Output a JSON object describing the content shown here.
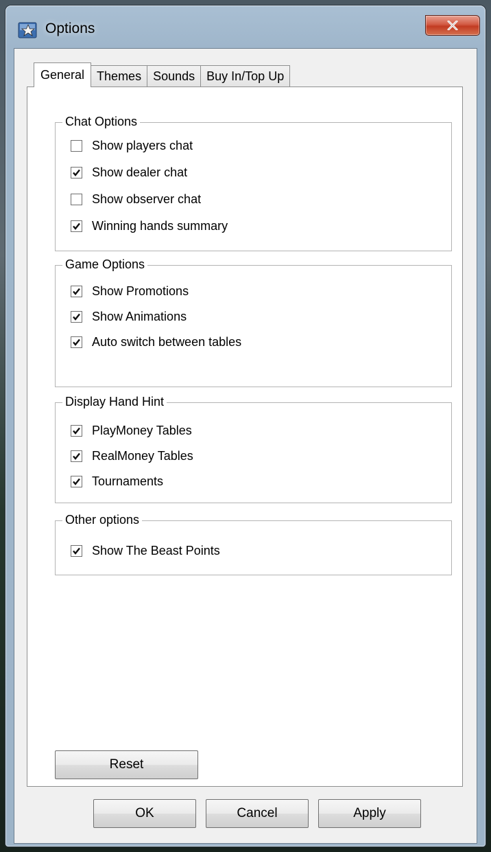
{
  "window": {
    "title": "Options",
    "close_icon": "close-icon",
    "app_icon": "star-app-icon"
  },
  "tabs": [
    {
      "label": "General",
      "active": true
    },
    {
      "label": "Themes",
      "active": false
    },
    {
      "label": "Sounds",
      "active": false
    },
    {
      "label": "Buy In/Top Up",
      "active": false
    }
  ],
  "groups": [
    {
      "legend": "Chat Options",
      "items": [
        {
          "label": "Show players chat",
          "checked": false
        },
        {
          "label": "Show dealer chat",
          "checked": true
        },
        {
          "label": "Show observer chat",
          "checked": false
        },
        {
          "label": "Winning hands summary",
          "checked": true
        }
      ]
    },
    {
      "legend": "Game Options",
      "items": [
        {
          "label": "Show Promotions",
          "checked": true
        },
        {
          "label": "Show Animations",
          "checked": true
        },
        {
          "label": "Auto switch between tables",
          "checked": true
        }
      ]
    },
    {
      "legend": "Display Hand Hint",
      "items": [
        {
          "label": "PlayMoney Tables",
          "checked": true
        },
        {
          "label": "RealMoney Tables",
          "checked": true
        },
        {
          "label": "Tournaments",
          "checked": true
        }
      ]
    },
    {
      "legend": "Other options",
      "items": [
        {
          "label": "Show The Beast Points",
          "checked": true
        }
      ]
    }
  ],
  "buttons": {
    "reset": "Reset",
    "ok": "OK",
    "cancel": "Cancel",
    "apply": "Apply"
  }
}
